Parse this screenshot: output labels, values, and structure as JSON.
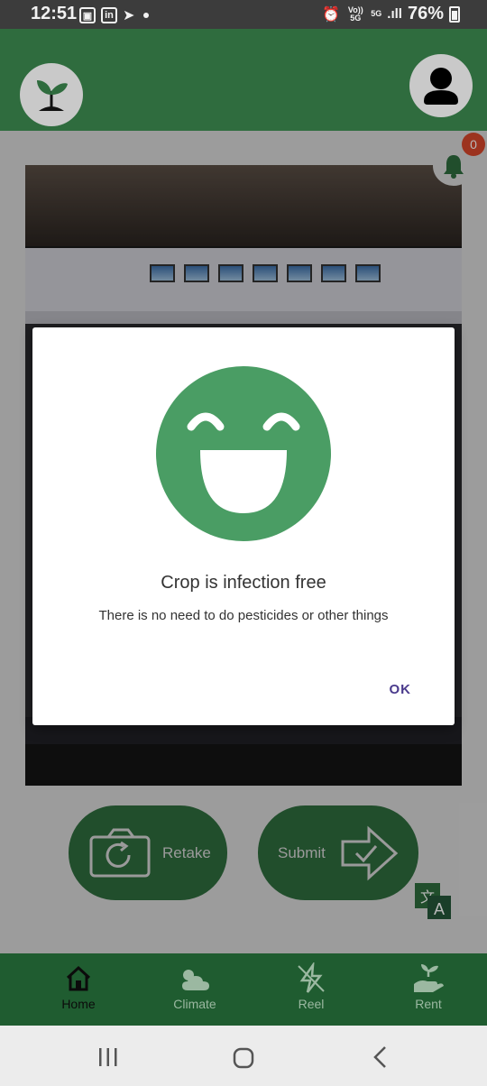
{
  "status_bar": {
    "time": "12:51",
    "left_icons": [
      "gallery-icon",
      "linkedin-icon",
      "telegram-icon"
    ],
    "volte_label": "Vo)) 5G",
    "net_label": "5G",
    "battery_text": "76%"
  },
  "header": {
    "logo_icon": "seedling-icon",
    "profile_icon": "user-icon"
  },
  "notifications": {
    "count": "0"
  },
  "actions": {
    "retake_label": "Retake",
    "submit_label": "Submit"
  },
  "bottom_nav": {
    "items": [
      {
        "label": "Home",
        "icon": "home-icon",
        "active": true
      },
      {
        "label": "Climate",
        "icon": "weather-icon",
        "active": false
      },
      {
        "label": "Reel",
        "icon": "lightning-icon",
        "active": false
      },
      {
        "label": "Rent",
        "icon": "hand-plant-icon",
        "active": false
      }
    ]
  },
  "dialog": {
    "title": "Crop is infection free",
    "message": "There is no need to do pesticides or other things",
    "ok_label": "OK"
  },
  "colors": {
    "brand_green": "#2f6c3e",
    "face_green": "#4a9d64",
    "badge_red": "#d9472b",
    "dialog_accent": "#4a3a8c"
  }
}
